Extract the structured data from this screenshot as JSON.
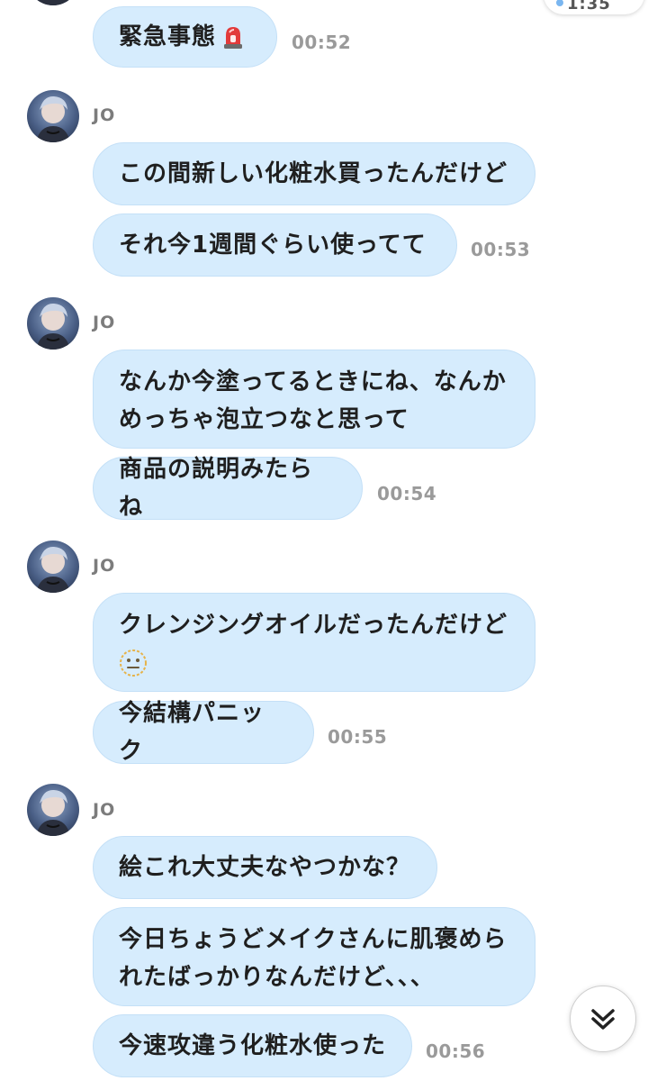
{
  "header": {
    "partial_chip_text": "1:35"
  },
  "groups": [
    {
      "sender": "",
      "messages": [
        {
          "text": "緊急事態",
          "emoji": "police-light-icon"
        }
      ],
      "time": "00:52"
    },
    {
      "sender": "JO",
      "messages": [
        {
          "text": "この間新しい化粧水買ったんだけど"
        },
        {
          "text": "それ今1週間ぐらい使ってて"
        }
      ],
      "time": "00:53"
    },
    {
      "sender": "JO",
      "messages": [
        {
          "line1": "なんか今塗ってるときにね、なんか",
          "line2": "めっちゃ泡立つなと思って"
        },
        {
          "text": "商品の説明みたらね"
        }
      ],
      "time": "00:54"
    },
    {
      "sender": "JO",
      "messages": [
        {
          "line1": "クレンジングオイルだったんだけど",
          "emoji": "neutral-face-icon"
        },
        {
          "text": "今結構パニック"
        }
      ],
      "time": "00:55"
    },
    {
      "sender": "JO",
      "messages": [
        {
          "text": "絵これ大丈夫なやつかな？"
        },
        {
          "line1": "今日ちょうどメイクさんに肌褒めら",
          "line2": "れたばっかりなんだけど、、、"
        },
        {
          "text": "今速攻違う化粧水使った"
        }
      ],
      "time": "00:56"
    }
  ],
  "colors": {
    "bubble": "#d6ecfd",
    "bubble_border": "#c4e0f7",
    "time": "#9a9a9a",
    "sender": "#7c7c7c"
  }
}
